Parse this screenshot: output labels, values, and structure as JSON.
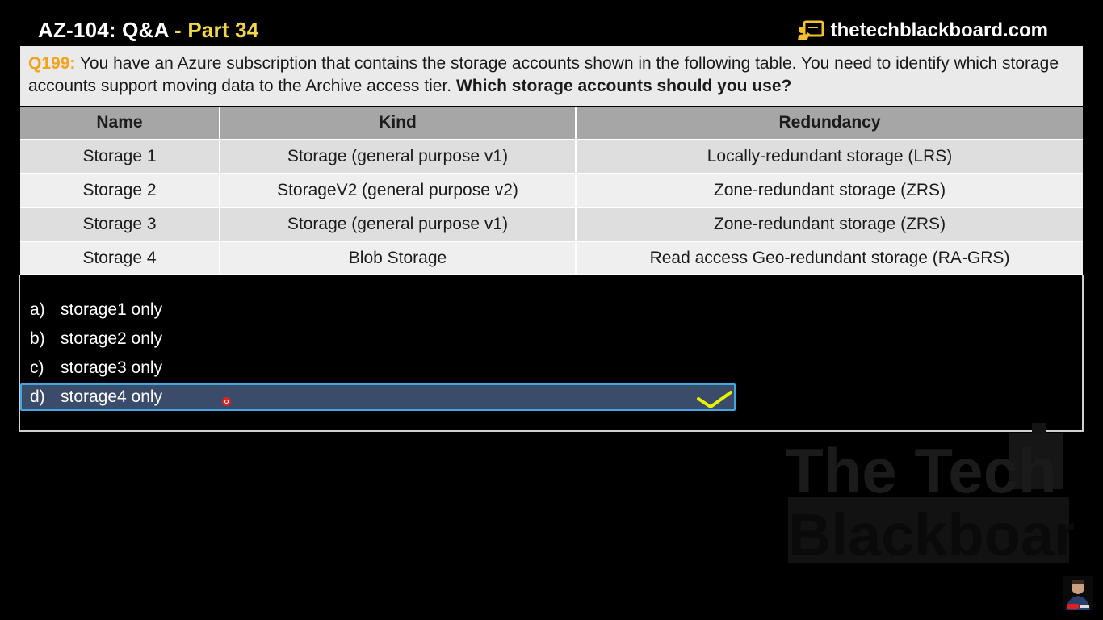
{
  "header": {
    "title_main": "AZ-104: Q&A",
    "title_sep": " - ",
    "title_part": "Part 34",
    "brand_text": "thetechblackboard.com"
  },
  "question": {
    "number": "Q199:",
    "text": " You have an Azure subscription that contains the storage accounts shown in the following table. You need to identify which storage accounts support moving data to the Archive access tier. ",
    "ask": "Which storage accounts should you use?"
  },
  "table": {
    "headers": [
      "Name",
      "Kind",
      "Redundancy"
    ],
    "rows": [
      [
        "Storage 1",
        "Storage (general purpose v1)",
        "Locally-redundant storage (LRS)"
      ],
      [
        "Storage 2",
        "StorageV2 (general purpose v2)",
        "Zone-redundant storage (ZRS)"
      ],
      [
        "Storage 3",
        "Storage (general purpose v1)",
        "Zone-redundant storage (ZRS)"
      ],
      [
        "Storage 4",
        "Blob Storage",
        "Read access Geo-redundant storage (RA-GRS)"
      ]
    ]
  },
  "options": [
    {
      "letter": "a)",
      "text": "storage1 only",
      "correct": false
    },
    {
      "letter": "b)",
      "text": "storage2 only",
      "correct": false
    },
    {
      "letter": "c)",
      "text": "storage3 only",
      "correct": false
    },
    {
      "letter": "d)",
      "text": "storage4 only",
      "correct": true
    }
  ],
  "watermark": {
    "line1": "The Tech",
    "line2": "Blackboard"
  },
  "icons": {
    "brand": "chalkboard-teacher-icon",
    "correct": "checkmark-icon",
    "cursor": "cursor-dot-icon",
    "avatar": "presenter-avatar-icon"
  },
  "colors": {
    "accent_yellow": "#f2d64b",
    "question_number": "#f2a31c",
    "correct_fill": "#3b4c6b",
    "correct_border": "#41a9e0",
    "check": "#e8f000",
    "table_header": "#a6a6a6"
  }
}
